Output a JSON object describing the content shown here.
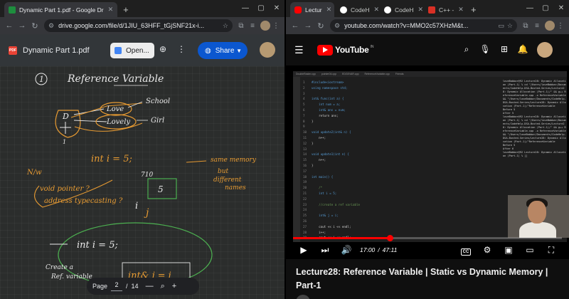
{
  "left_window": {
    "tabs": [
      {
        "title": "Dynamic Part 1.pdf - Google Dr",
        "active": true,
        "favicon_color": "#1e8e3e"
      }
    ],
    "address": "drive.google.com/file/d/1JIU_63HFF_tGjSNF21x-i...",
    "pdf": {
      "file_name": "Dynamic Part 1.pdf",
      "badge": "PDF",
      "open_label": "Open...",
      "share_label": "Share",
      "page_label": "Page",
      "current_page": "2",
      "page_separator": "/",
      "total_pages": "14"
    },
    "notes": {
      "circled_number": "1",
      "heading": "Reference Variable",
      "school": "School",
      "love": "Love",
      "lovely": "Lovely",
      "girl": "Girl",
      "d_label": "D",
      "d_sub": "1",
      "nw": "N/w",
      "code_decl": "int   i  = 5;",
      "q1": "void pointer ?",
      "q2": "address typecasting ?",
      "addr_value": "710",
      "box_value": "5",
      "var_i": "i",
      "var_j": "j",
      "same_memory": "same memory",
      "but_different": "but",
      "different_names": "different",
      "names_word": "names",
      "code_decl2": "int  i = 5;",
      "create": "Create  a",
      "ref": "Ref.   variable",
      "code_ref": "int& j = i"
    }
  },
  "right_window": {
    "tabs": [
      {
        "title": "Lectur",
        "favicon_color": "#ff0000",
        "active": true
      },
      {
        "title": "CodeH",
        "favicon_color": "#ffffff",
        "active": false
      },
      {
        "title": "CodeH",
        "favicon_color": "#ffffff",
        "active": false
      },
      {
        "title": "C++ -",
        "favicon_color": "#d93025",
        "active": false
      }
    ],
    "address": "youtube.com/watch?v=MMO2c57XHzM&t...",
    "youtube": {
      "logo_text": "YouTube",
      "region": "IN",
      "time_current": "17:00",
      "time_separator": "/",
      "time_total": "47:11",
      "progress_fraction": 0.36,
      "cc_label": "CC",
      "video_title": "Lecture28: Reference Variable | Static vs Dynamic Memory | Part-1"
    },
    "video_content": {
      "editor_tabs": [
        "DoubleRaster.cpp",
        "pointer04.cpp",
        "EDGEVAR.cpp",
        "ReferenceVariable.cpp",
        "Friends"
      ],
      "code_lines": [
        "#include<iostream>",
        "using namespace std;",
        "",
        "int& func(int a) {",
        "    int num = a;",
        "    int& ans = num;",
        "    return ans;",
        "}",
        "",
        "void update2(int& n) {",
        "    n++;",
        "}",
        "",
        "void update1(int n) {",
        "    n++;",
        "}",
        "",
        "int main() {",
        "",
        "    /*",
        "    int i = 5;",
        "",
        "    //create a ref variable",
        "",
        "    int& j = i;",
        "",
        "    cout << i << endl;",
        "    i++;",
        "    cout << i << endl;"
      ],
      "terminal_lines": [
        "loveBabbar@92 Lecture28: Dynamic Allocation (Part-1) % cd \"/Users/loveBabbar/Documents/CodeHelp-DSA-Busted-Series/Lecture28: Dynamic Allocation (Part-1)/\" && g++ ReferenceVariable.cpp -o ReferenceVariable && \"/Users/loveBabbar/Documents/CodeHelp-DSA-Busted-Series/Lecture28: Dynamic Allocation (Part-1)/\"ReferenceVariable",
        "Before 5",
        "After 5",
        "loveBabbar@92 Lecture28: Dynamic Allocation (Part-1) % cd \"/Users/loveBabbar/Documents/CodeHelp-DSA-Busted-Series/Lecture28: Dynamic Allocation (Part-1)/\" && g++ ReferenceVariable.cpp -o ReferenceVariable && \"/Users/loveBabbar/Documents/CodeHelp-DSA-Busted-Series/Lecture28: Dynamic Allocation (Part-1)/\"ReferenceVariable",
        "Before 5",
        "After 6",
        "loveBabbar@92 Lecture28: Dynamic Allocation (Part-1) % []"
      ]
    }
  }
}
